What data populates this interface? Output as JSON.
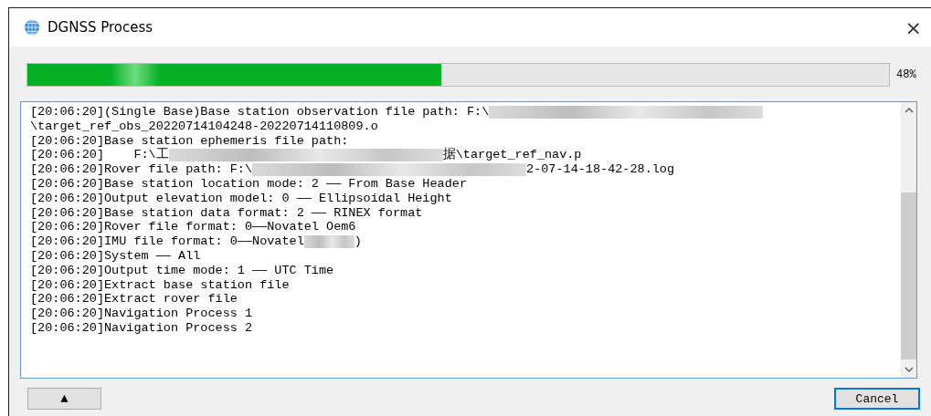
{
  "window": {
    "title": "DGNSS Process",
    "close": "×"
  },
  "progress": {
    "level": 0.48,
    "reading": "48%"
  },
  "log": [
    {
      "parts": [
        {
          "kind": "text",
          "text": "[20:06:20](Single Base)Base station observation file path: F:\\"
        },
        {
          "kind": "blur"
        }
      ]
    },
    {
      "parts": [
        {
          "kind": "text",
          "text": "\\target_ref_obs_20220714104248-20220714110809.o"
        }
      ]
    },
    {
      "parts": [
        {
          "kind": "text",
          "text": "[20:06:20]Base station ephemeris file path:"
        }
      ]
    },
    {
      "parts": [
        {
          "kind": "text",
          "text": "[20:06:20]    F:\\工"
        },
        {
          "kind": "blur"
        },
        {
          "kind": "text",
          "text": "据\\target_ref_nav.p"
        }
      ]
    },
    {
      "parts": [
        {
          "kind": "text",
          "text": "[20:06:20]Rover file path: F:\\"
        },
        {
          "kind": "blur"
        },
        {
          "kind": "text",
          "text": "2-07-14-18-42-28.log"
        }
      ]
    },
    {
      "parts": [
        {
          "kind": "text",
          "text": "[20:06:20]Base station location mode: 2 —— From Base Header"
        }
      ]
    },
    {
      "parts": [
        {
          "kind": "text",
          "text": "[20:06:20]Output elevation model: 0 —— Ellipsoidal Height"
        }
      ]
    },
    {
      "parts": [
        {
          "kind": "text",
          "text": "[20:06:20]Base station data format: 2 —— RINEX format"
        }
      ]
    },
    {
      "parts": [
        {
          "kind": "text",
          "text": "[20:06:20]Rover file format: 0——Novatel Oem6"
        }
      ]
    },
    {
      "parts": [
        {
          "kind": "text",
          "text": "[20:06:20]IMU file format: 0——Novatel"
        },
        {
          "kind": "blur-small"
        },
        {
          "kind": "text",
          "text": ")"
        }
      ]
    },
    {
      "parts": [
        {
          "kind": "text",
          "text": "[20:06:20]System —— All"
        }
      ]
    },
    {
      "parts": [
        {
          "kind": "text",
          "text": "[20:06:20]Output time mode: 1 —— UTC Time"
        }
      ]
    },
    {
      "parts": [
        {
          "kind": "text",
          "text": "[20:06:20]Extract base station file"
        }
      ]
    },
    {
      "parts": [
        {
          "kind": "text",
          "text": "[20:06:20]Extract rover file"
        }
      ]
    },
    {
      "parts": [
        {
          "kind": "text",
          "text": "[20:06:20]Navigation Process 1"
        }
      ]
    },
    {
      "parts": [
        {
          "kind": "text",
          "text": "[20:06:20]Navigation Process 2"
        }
      ]
    }
  ],
  "buttons": {
    "expand": "▲",
    "cancel": "Cancel"
  }
}
